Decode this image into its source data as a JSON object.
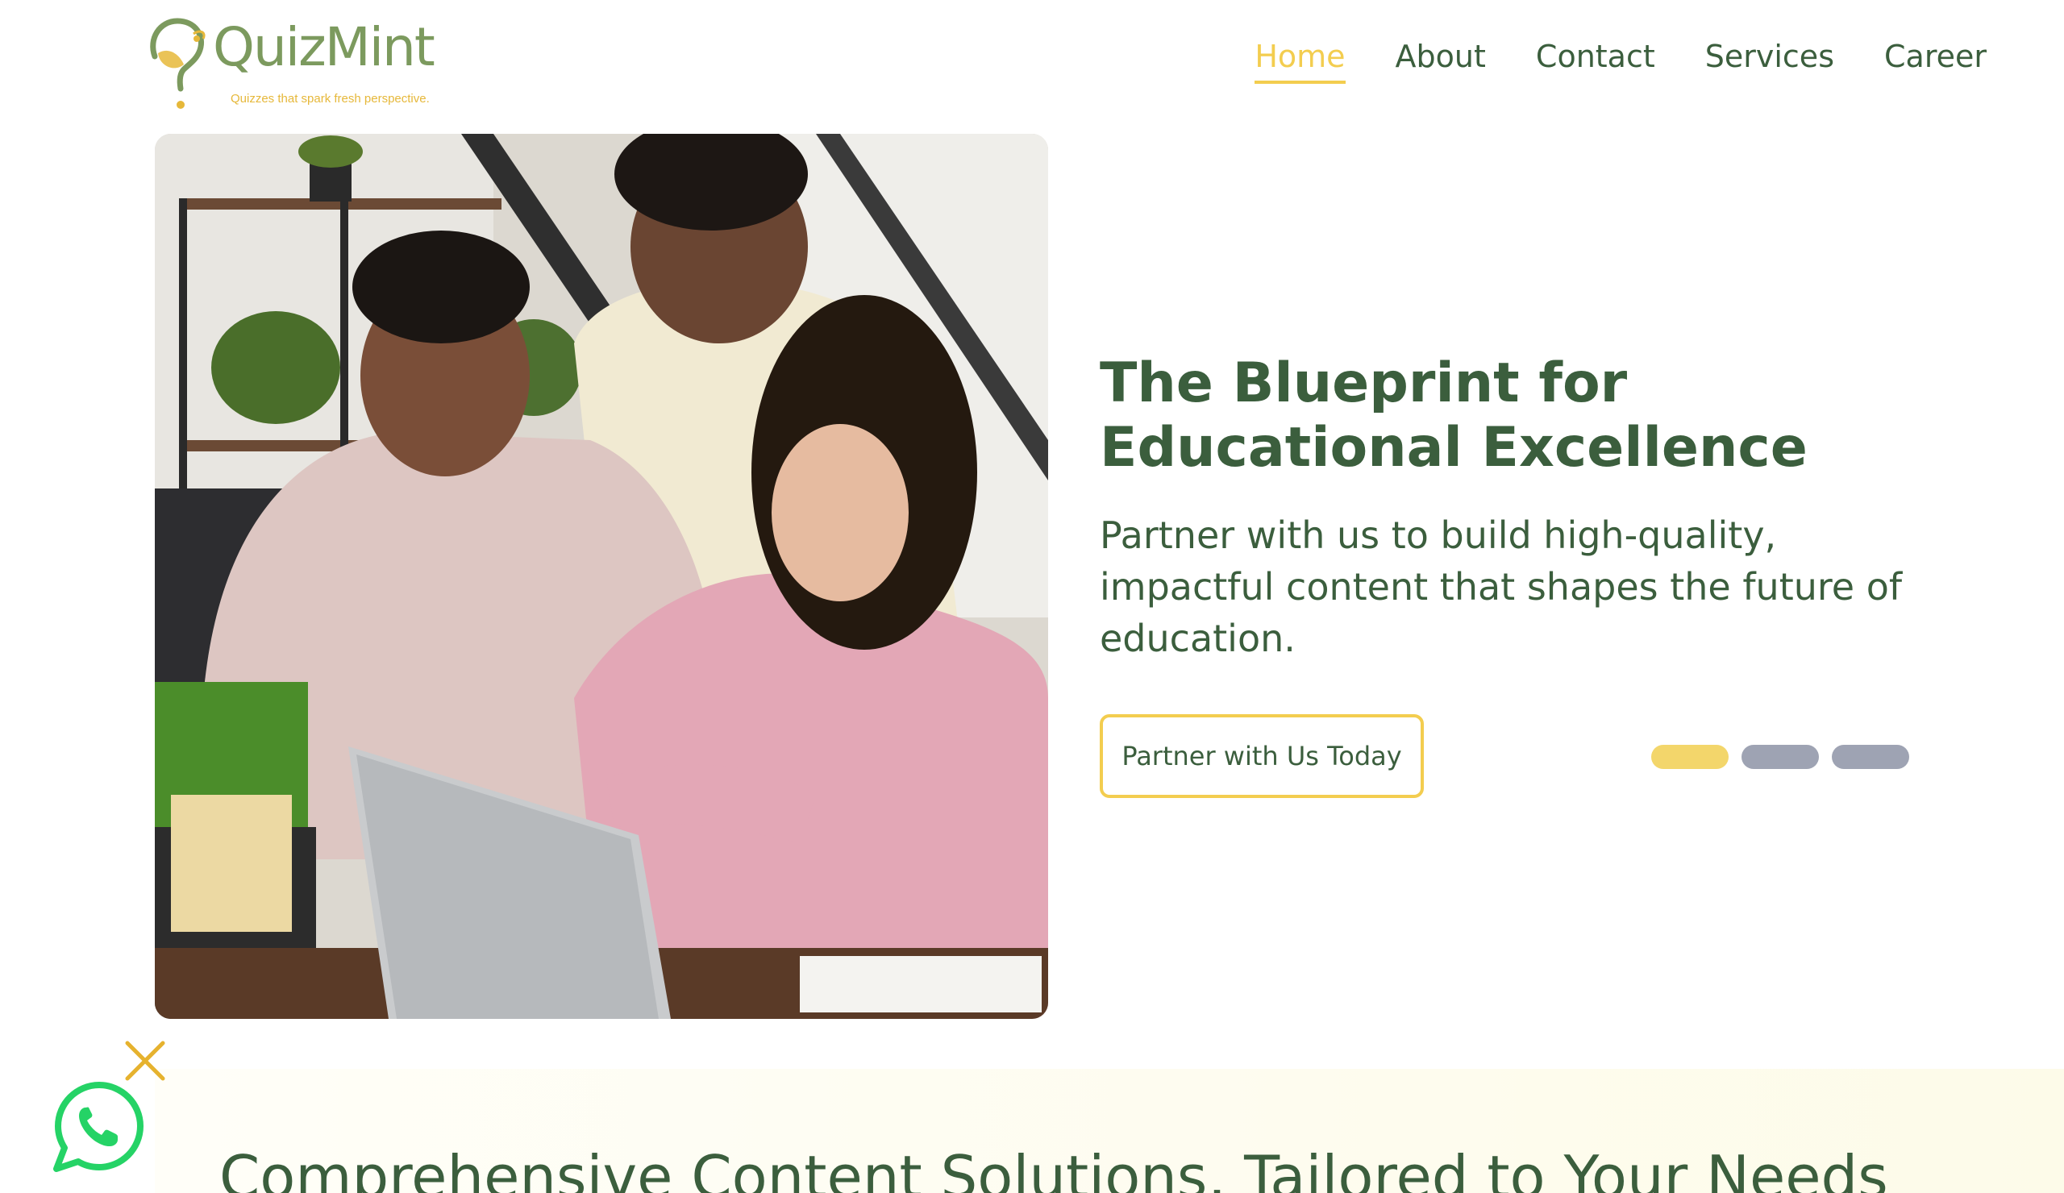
{
  "brand": {
    "name": "QuizMint",
    "tagline": "Quizzes that spark fresh perspective.",
    "logo_icon": "question-mark-leaf-icon",
    "colors": {
      "primary_green": "#3b5e3d",
      "logo_green": "#7c9a5e",
      "accent_yellow": "#f3cd4f",
      "dot_inactive": "#9ea3b3",
      "whatsapp_green": "#25d366"
    }
  },
  "nav": {
    "items": [
      {
        "label": "Home",
        "active": true
      },
      {
        "label": "About",
        "active": false
      },
      {
        "label": "Contact",
        "active": false
      },
      {
        "label": "Services",
        "active": false
      },
      {
        "label": "Career",
        "active": false
      }
    ]
  },
  "hero": {
    "image_alt": "three-colleagues-working-at-laptop",
    "title": "The Blueprint for Educational Excellence",
    "subtitle": "Partner with us to build high-quality, impactful content that shapes the future of education.",
    "cta_label": "Partner with Us Today",
    "carousel": {
      "slide_count": 3,
      "active_index": 0
    }
  },
  "section2": {
    "title": "Comprehensive Content Solutions, Tailored to Your Needs"
  },
  "whatsapp": {
    "icon": "whatsapp-icon",
    "close_icon": "close-icon"
  }
}
